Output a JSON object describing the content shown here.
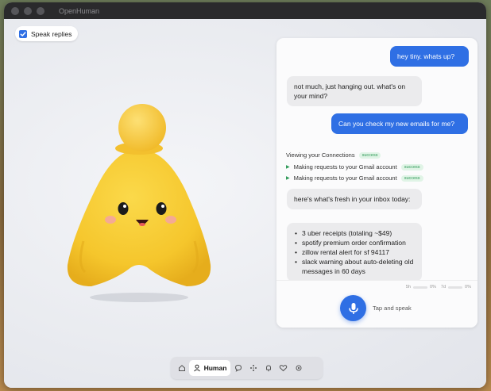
{
  "window": {
    "title": "OpenHuman"
  },
  "speak_replies": {
    "label": "Speak replies",
    "checked": true
  },
  "chat": {
    "messages": [
      {
        "role": "user",
        "text": "hey tiny. whats up?"
      },
      {
        "role": "assistant",
        "text": "not much, just hanging out. what's on your mind?"
      },
      {
        "role": "user",
        "text": "Can you check my new emails for me?"
      }
    ],
    "tools": [
      {
        "label": "Viewing your Connections",
        "status": "success"
      },
      {
        "label": "Making requests to your Gmail account",
        "status": "success"
      },
      {
        "label": "Making requests to your Gmail account",
        "status": "success"
      }
    ],
    "reply_intro": "here's what's fresh in your inbox today:",
    "reply_items": [
      "3 uber receipts (totaling ~$49)",
      "spotify premium order confirmation",
      "zillow rental alert for sf 94117",
      "slack warning about auto-deleting old messages in 60 days"
    ]
  },
  "footer": {
    "stats": [
      {
        "label": "5h",
        "value": "0%"
      },
      {
        "label": "7d",
        "value": "0%"
      }
    ],
    "tap_label": "Tap and speak"
  },
  "nav": {
    "items": [
      {
        "icon": "home-icon",
        "label": ""
      },
      {
        "icon": "person-icon",
        "label": "Human",
        "active": true
      },
      {
        "icon": "chat-icon",
        "label": ""
      },
      {
        "icon": "sparkle-icon",
        "label": ""
      },
      {
        "icon": "bell-icon",
        "label": ""
      },
      {
        "icon": "heart-icon",
        "label": ""
      },
      {
        "icon": "gear-icon",
        "label": ""
      }
    ]
  },
  "colors": {
    "accent": "#2f6fe4",
    "mascot": "#f7c933",
    "success": "#2f9a58"
  }
}
